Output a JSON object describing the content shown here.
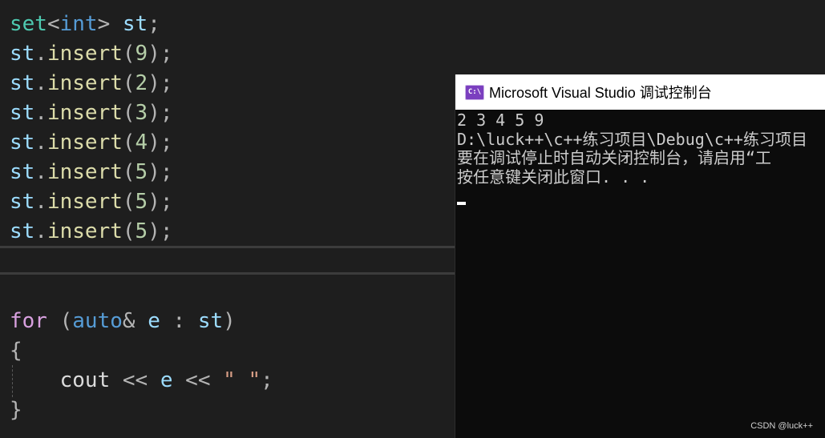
{
  "editor": {
    "lines": [
      [
        {
          "t": "set",
          "c": "type"
        },
        {
          "t": "<",
          "c": "punc"
        },
        {
          "t": "int",
          "c": "kw"
        },
        {
          "t": "> ",
          "c": "punc"
        },
        {
          "t": "st",
          "c": "var"
        },
        {
          "t": ";",
          "c": "punc"
        }
      ],
      [
        {
          "t": "st",
          "c": "var"
        },
        {
          "t": ".",
          "c": "punc"
        },
        {
          "t": "insert",
          "c": "fn"
        },
        {
          "t": "(",
          "c": "punc"
        },
        {
          "t": "9",
          "c": "num"
        },
        {
          "t": ");",
          "c": "punc"
        }
      ],
      [
        {
          "t": "st",
          "c": "var"
        },
        {
          "t": ".",
          "c": "punc"
        },
        {
          "t": "insert",
          "c": "fn"
        },
        {
          "t": "(",
          "c": "punc"
        },
        {
          "t": "2",
          "c": "num"
        },
        {
          "t": ");",
          "c": "punc"
        }
      ],
      [
        {
          "t": "st",
          "c": "var"
        },
        {
          "t": ".",
          "c": "punc"
        },
        {
          "t": "insert",
          "c": "fn"
        },
        {
          "t": "(",
          "c": "punc"
        },
        {
          "t": "3",
          "c": "num"
        },
        {
          "t": ");",
          "c": "punc"
        }
      ],
      [
        {
          "t": "st",
          "c": "var"
        },
        {
          "t": ".",
          "c": "punc"
        },
        {
          "t": "insert",
          "c": "fn"
        },
        {
          "t": "(",
          "c": "punc"
        },
        {
          "t": "4",
          "c": "num"
        },
        {
          "t": ");",
          "c": "punc"
        }
      ],
      [
        {
          "t": "st",
          "c": "var"
        },
        {
          "t": ".",
          "c": "punc"
        },
        {
          "t": "insert",
          "c": "fn"
        },
        {
          "t": "(",
          "c": "punc"
        },
        {
          "t": "5",
          "c": "num"
        },
        {
          "t": ");",
          "c": "punc"
        }
      ],
      [
        {
          "t": "st",
          "c": "var"
        },
        {
          "t": ".",
          "c": "punc"
        },
        {
          "t": "insert",
          "c": "fn"
        },
        {
          "t": "(",
          "c": "punc"
        },
        {
          "t": "5",
          "c": "num"
        },
        {
          "t": ");",
          "c": "punc"
        }
      ],
      [
        {
          "t": "st",
          "c": "var"
        },
        {
          "t": ".",
          "c": "punc"
        },
        {
          "t": "insert",
          "c": "fn"
        },
        {
          "t": "(",
          "c": "punc"
        },
        {
          "t": "5",
          "c": "num"
        },
        {
          "t": ");",
          "c": "punc"
        }
      ],
      [
        {
          "t": "for",
          "c": "kw-for"
        },
        {
          "t": " (",
          "c": "punc"
        },
        {
          "t": "auto",
          "c": "kw"
        },
        {
          "t": "& ",
          "c": "punc"
        },
        {
          "t": "e",
          "c": "var"
        },
        {
          "t": " : ",
          "c": "punc"
        },
        {
          "t": "st",
          "c": "var"
        },
        {
          "t": ")",
          "c": "punc"
        }
      ],
      [
        {
          "t": "{",
          "c": "punc"
        }
      ],
      [
        {
          "t": "    cout ",
          "c": "plain"
        },
        {
          "t": "<< ",
          "c": "punc"
        },
        {
          "t": "e",
          "c": "var"
        },
        {
          "t": " << ",
          "c": "punc"
        },
        {
          "t": "\" \"",
          "c": "str"
        },
        {
          "t": ";",
          "c": "punc"
        }
      ],
      [
        {
          "t": "}",
          "c": "punc"
        }
      ]
    ]
  },
  "console": {
    "icon_text": "C:\\",
    "title": "Microsoft Visual Studio 调试控制台",
    "output": [
      "2 3 4 5 9",
      "D:\\luck++\\c++练习项目\\Debug\\c++练习项目",
      "要在调试停止时自动关闭控制台，请启用“工",
      "按任意键关闭此窗口. . ."
    ]
  },
  "watermark": "CSDN @luck++",
  "colors": {
    "editor_bg": "#1e1e1e",
    "console_bg": "#0c0c0c",
    "keyword": "#569cd6",
    "control_keyword": "#d8a0df",
    "type": "#4ec9b0",
    "variable": "#9cdcfe",
    "function": "#dcdcaa",
    "number": "#b5cea8",
    "string": "#d69d85"
  }
}
